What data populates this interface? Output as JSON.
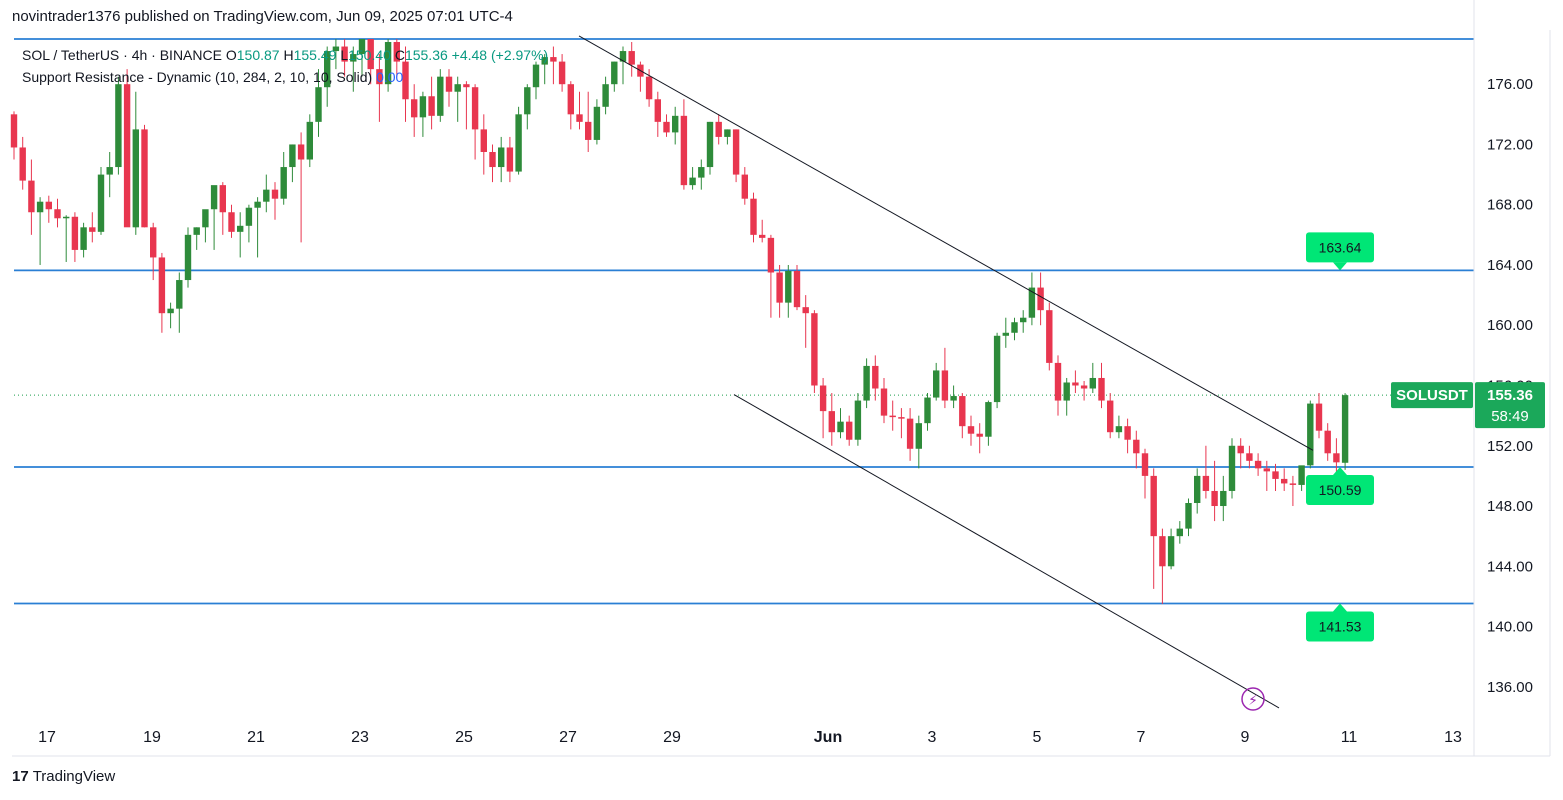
{
  "header": {
    "publisher": "novintrader1376 published on TradingView.com, Jun 09, 2025 07:01 UTC-4"
  },
  "legend": {
    "symbol": "SOL / TetherUS · 4h · BINANCE",
    "o_label": "O",
    "o_value": "150.87",
    "h_label": "H",
    "h_value": "155.49",
    "l_label": "L",
    "l_value": "150.40",
    "c_label": "C",
    "c_value": "155.36",
    "change": "+4.48 (+2.97%)",
    "indicator": "Support Resistance - Dynamic (10, 284, 2, 10, 10, Solid)",
    "indicator_value": "0.00"
  },
  "footer": {
    "brand": "TradingView",
    "logo_glyph": "17"
  },
  "price_tag": {
    "symbol": "SOLUSDT",
    "price": "155.36",
    "countdown": "58:49"
  },
  "colors": {
    "up": "#089981",
    "down": "#f23645",
    "level": "#2a7fd4",
    "tag_green": "#1ba85a",
    "label_green": "#00e676"
  },
  "chart_data": {
    "type": "candlestick",
    "timeframe": "4h",
    "y_range": [
      133,
      179
    ],
    "y_ticks": [
      "176.00",
      "172.00",
      "168.00",
      "164.00",
      "160.00",
      "156.00",
      "152.00",
      "148.00",
      "144.00",
      "140.00",
      "136.00"
    ],
    "x_ticks": [
      "17",
      "19",
      "21",
      "23",
      "25",
      "27",
      "29",
      "Jun",
      "3",
      "5",
      "7",
      "9",
      "11",
      "13"
    ],
    "levels": [
      {
        "value": 179,
        "label": ""
      },
      {
        "value": 163.64,
        "label": "163.64"
      },
      {
        "value": 150.59,
        "label": "150.59"
      },
      {
        "value": 141.53,
        "label": "141.53"
      }
    ],
    "trendlines": [
      {
        "name": "channel-top",
        "from": [
          "May 27 04:00",
          179.2
        ],
        "to": [
          "Jun 10 12:00",
          151.7
        ]
      },
      {
        "name": "channel-bottom",
        "from": [
          "May 30 08:00",
          155.4
        ],
        "to": [
          "Jun 10 04:00",
          134.6
        ]
      }
    ],
    "last_price": 155.36,
    "candles": [
      [
        174.0,
        174.2,
        171.0,
        171.8
      ],
      [
        171.8,
        172.5,
        169.0,
        169.6
      ],
      [
        169.6,
        171.0,
        166.0,
        167.5
      ],
      [
        167.5,
        168.5,
        164.0,
        168.2
      ],
      [
        168.2,
        168.6,
        166.8,
        167.7
      ],
      [
        167.7,
        168.4,
        166.5,
        167.1
      ],
      [
        167.1,
        167.3,
        164.2,
        167.2
      ],
      [
        167.2,
        167.5,
        164.2,
        165.0
      ],
      [
        165.0,
        166.8,
        164.5,
        166.5
      ],
      [
        166.5,
        167.5,
        165.5,
        166.2
      ],
      [
        166.2,
        170.5,
        166.0,
        170.0
      ],
      [
        170.0,
        171.5,
        168.5,
        170.5
      ],
      [
        170.5,
        176.5,
        170.0,
        176.0
      ],
      [
        176.0,
        177.0,
        168.0,
        166.5
      ],
      [
        166.5,
        175.5,
        166.0,
        173.0
      ],
      [
        173.0,
        173.3,
        166.5,
        166.5
      ],
      [
        166.5,
        166.8,
        163.0,
        164.5
      ],
      [
        164.5,
        164.8,
        159.5,
        160.8
      ],
      [
        160.8,
        161.5,
        159.8,
        161.1
      ],
      [
        161.1,
        163.5,
        159.5,
        163.0
      ],
      [
        163.0,
        166.5,
        162.5,
        166.0
      ],
      [
        166.0,
        166.5,
        165.0,
        166.5
      ],
      [
        166.5,
        167.5,
        165.5,
        167.7
      ],
      [
        167.7,
        169.0,
        165.0,
        169.3
      ],
      [
        169.3,
        169.5,
        166.0,
        167.5
      ],
      [
        167.5,
        168.0,
        165.8,
        166.2
      ],
      [
        166.2,
        167.5,
        164.5,
        166.6
      ],
      [
        166.6,
        168.0,
        165.5,
        167.8
      ],
      [
        167.8,
        168.5,
        164.5,
        168.2
      ],
      [
        168.2,
        170.0,
        167.5,
        169.0
      ],
      [
        169.0,
        169.5,
        167.0,
        168.4
      ],
      [
        168.4,
        171.5,
        168.0,
        170.5
      ],
      [
        170.5,
        172.0,
        169.5,
        172.0
      ],
      [
        172.0,
        172.8,
        165.5,
        171.0
      ],
      [
        171.0,
        174.0,
        170.5,
        173.5
      ],
      [
        173.5,
        177.0,
        172.5,
        175.8
      ],
      [
        175.8,
        178.5,
        174.5,
        178.2
      ],
      [
        178.2,
        179.0,
        177.0,
        178.5
      ],
      [
        178.5,
        179.0,
        176.5,
        177.5
      ],
      [
        177.5,
        178.5,
        175.5,
        178.0
      ],
      [
        178.0,
        179.0,
        176.5,
        179.0
      ],
      [
        179.0,
        179.0,
        176.0,
        177.0
      ],
      [
        177.0,
        178.0,
        173.5,
        176.0
      ],
      [
        176.0,
        179.0,
        175.5,
        178.8
      ],
      [
        178.8,
        179.0,
        176.5,
        177.5
      ],
      [
        177.5,
        178.5,
        173.5,
        175.0
      ],
      [
        175.0,
        176.0,
        172.5,
        173.8
      ],
      [
        173.8,
        175.5,
        172.5,
        175.2
      ],
      [
        175.2,
        176.5,
        173.0,
        173.9
      ],
      [
        173.9,
        177.0,
        173.5,
        176.5
      ],
      [
        176.5,
        177.0,
        174.5,
        175.5
      ],
      [
        175.5,
        176.5,
        173.5,
        176.0
      ],
      [
        176.0,
        176.2,
        173.0,
        175.8
      ],
      [
        175.8,
        176.0,
        171.0,
        173.0
      ],
      [
        173.0,
        174.0,
        170.0,
        171.5
      ],
      [
        171.5,
        172.0,
        169.5,
        170.5
      ],
      [
        170.5,
        172.5,
        169.5,
        171.8
      ],
      [
        171.8,
        172.5,
        169.5,
        170.2
      ],
      [
        170.2,
        174.5,
        170.0,
        174.0
      ],
      [
        174.0,
        176.0,
        173.0,
        175.8
      ],
      [
        175.8,
        177.5,
        175.0,
        177.3
      ],
      [
        177.3,
        178.0,
        176.0,
        177.8
      ],
      [
        177.8,
        178.5,
        176.0,
        177.5
      ],
      [
        177.5,
        178.0,
        175.5,
        176.0
      ],
      [
        176.0,
        176.2,
        173.0,
        174.0
      ],
      [
        174.0,
        175.5,
        173.0,
        173.5
      ],
      [
        173.5,
        175.5,
        171.5,
        172.3
      ],
      [
        172.3,
        175.0,
        172.0,
        174.5
      ],
      [
        174.5,
        176.5,
        174.0,
        176.0
      ],
      [
        176.0,
        177.5,
        175.5,
        177.5
      ],
      [
        177.5,
        178.5,
        176.0,
        178.2
      ],
      [
        178.2,
        178.8,
        176.5,
        177.3
      ],
      [
        177.3,
        177.5,
        175.5,
        176.5
      ],
      [
        176.5,
        177.0,
        174.5,
        175.0
      ],
      [
        175.0,
        175.5,
        172.5,
        173.5
      ],
      [
        173.5,
        174.0,
        172.5,
        172.8
      ],
      [
        172.8,
        174.5,
        172.0,
        173.9
      ],
      [
        173.9,
        175.0,
        169.0,
        169.3
      ],
      [
        169.3,
        170.5,
        169.0,
        169.8
      ],
      [
        169.8,
        171.0,
        169.0,
        170.5
      ],
      [
        170.5,
        173.5,
        170.0,
        173.5
      ],
      [
        173.5,
        174.0,
        172.0,
        172.5
      ],
      [
        172.5,
        173.0,
        172.0,
        173.0
      ],
      [
        173.0,
        173.0,
        169.5,
        170.0
      ],
      [
        170.0,
        170.5,
        168.0,
        168.4
      ],
      [
        168.4,
        168.8,
        165.5,
        166.0
      ],
      [
        166.0,
        167.0,
        165.5,
        165.8
      ],
      [
        165.8,
        166.0,
        160.5,
        163.5
      ],
      [
        163.5,
        164.0,
        160.5,
        161.5
      ],
      [
        161.5,
        164.0,
        160.5,
        163.6
      ],
      [
        163.6,
        164.0,
        161.0,
        161.2
      ],
      [
        161.2,
        162.0,
        158.5,
        160.8
      ],
      [
        160.8,
        161.0,
        155.5,
        156.0
      ],
      [
        156.0,
        156.5,
        152.5,
        154.3
      ],
      [
        154.3,
        155.5,
        152.0,
        152.9
      ],
      [
        152.9,
        154.5,
        152.5,
        153.6
      ],
      [
        153.6,
        154.0,
        152.0,
        152.4
      ],
      [
        152.4,
        155.5,
        152.0,
        155.0
      ],
      [
        155.0,
        157.8,
        154.5,
        157.3
      ],
      [
        157.3,
        158.0,
        155.0,
        155.8
      ],
      [
        155.8,
        156.5,
        153.5,
        154.0
      ],
      [
        154.0,
        155.0,
        153.0,
        153.9
      ],
      [
        153.9,
        154.5,
        152.5,
        153.8
      ],
      [
        153.8,
        154.5,
        151.0,
        151.8
      ],
      [
        151.8,
        154.0,
        150.5,
        153.5
      ],
      [
        153.5,
        155.5,
        153.0,
        155.2
      ],
      [
        155.2,
        157.5,
        155.0,
        157.0
      ],
      [
        157.0,
        158.5,
        154.5,
        155.0
      ],
      [
        155.0,
        156.0,
        154.5,
        155.3
      ],
      [
        155.3,
        155.5,
        152.5,
        153.3
      ],
      [
        153.3,
        154.0,
        152.0,
        152.8
      ],
      [
        152.8,
        153.5,
        151.5,
        152.6
      ],
      [
        152.6,
        155.0,
        152.0,
        154.9
      ],
      [
        154.9,
        159.5,
        154.5,
        159.3
      ],
      [
        159.3,
        160.5,
        158.5,
        159.5
      ],
      [
        159.5,
        160.5,
        159.0,
        160.2
      ],
      [
        160.2,
        161.0,
        159.5,
        160.5
      ],
      [
        160.5,
        163.5,
        160.0,
        162.5
      ],
      [
        162.5,
        163.5,
        160.0,
        161.0
      ],
      [
        161.0,
        161.5,
        157.0,
        157.5
      ],
      [
        157.5,
        158.0,
        154.0,
        155.0
      ],
      [
        155.0,
        156.5,
        154.0,
        156.2
      ],
      [
        156.2,
        157.0,
        155.5,
        156.0
      ],
      [
        156.0,
        156.3,
        155.0,
        155.8
      ],
      [
        155.8,
        157.5,
        155.5,
        156.5
      ],
      [
        156.5,
        157.5,
        154.5,
        155.0
      ],
      [
        155.0,
        155.5,
        152.5,
        152.9
      ],
      [
        152.9,
        154.0,
        152.5,
        153.3
      ],
      [
        153.3,
        153.8,
        151.5,
        152.4
      ],
      [
        152.4,
        153.0,
        150.5,
        151.5
      ],
      [
        151.5,
        151.8,
        148.5,
        150.0
      ],
      [
        150.0,
        150.5,
        142.5,
        146.0
      ],
      [
        146.0,
        146.5,
        141.5,
        144.0
      ],
      [
        144.0,
        146.5,
        143.8,
        146.0
      ],
      [
        146.0,
        147.0,
        145.5,
        146.5
      ],
      [
        146.5,
        148.5,
        146.0,
        148.2
      ],
      [
        148.2,
        150.5,
        147.5,
        150.0
      ],
      [
        150.0,
        152.0,
        148.5,
        149.0
      ],
      [
        149.0,
        151.0,
        147.0,
        148.0
      ],
      [
        148.0,
        150.0,
        147.0,
        149.0
      ],
      [
        149.0,
        152.5,
        148.5,
        152.0
      ],
      [
        152.0,
        152.5,
        150.5,
        151.5
      ],
      [
        151.5,
        152.0,
        150.5,
        151.0
      ],
      [
        151.0,
        151.5,
        150.0,
        150.5
      ],
      [
        150.5,
        151.0,
        149.0,
        150.3
      ],
      [
        150.3,
        150.8,
        149.0,
        149.8
      ],
      [
        149.8,
        150.5,
        149.0,
        149.5
      ],
      [
        149.5,
        150.0,
        148.0,
        149.4
      ],
      [
        149.4,
        150.5,
        149.0,
        150.7
      ],
      [
        150.7,
        155.0,
        150.5,
        154.8
      ],
      [
        154.8,
        155.5,
        152.5,
        153.0
      ],
      [
        153.0,
        153.5,
        151.0,
        151.5
      ],
      [
        151.5,
        152.5,
        149.5,
        150.9
      ],
      [
        150.87,
        155.49,
        150.4,
        155.36
      ]
    ]
  }
}
